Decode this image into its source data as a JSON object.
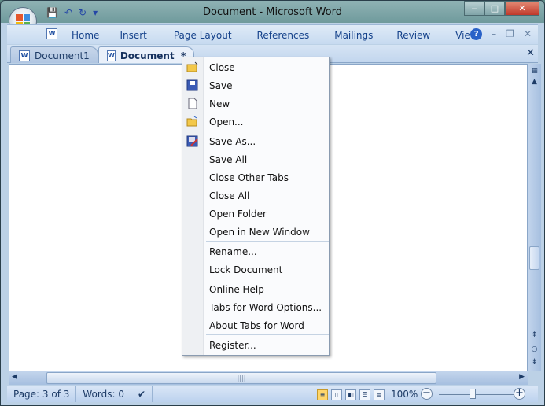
{
  "window": {
    "title": "Document - Microsoft Word",
    "minimize": "‒",
    "maximize": "□",
    "close": "✕"
  },
  "qat": {
    "save_icon": "💾",
    "undo": "↶",
    "redo": "↻",
    "customize": "▾"
  },
  "ribbon": {
    "tabs": [
      "Home",
      "Insert",
      "Page Layout",
      "References",
      "Mailings",
      "Review",
      "View"
    ]
  },
  "doc_tabs": [
    {
      "label": "Document1"
    },
    {
      "label": "Document  *"
    }
  ],
  "menu": {
    "groups": [
      [
        {
          "label": "Close",
          "u": 0,
          "icon": "close-folder"
        },
        {
          "label": "Save",
          "u": 0,
          "icon": "save"
        },
        {
          "label": "New",
          "u": 0,
          "icon": "new"
        },
        {
          "label": "Open...",
          "u": 0,
          "icon": "open"
        }
      ],
      [
        {
          "label": "Save As...",
          "u": 5,
          "icon": "save-as"
        },
        {
          "label": "Save All",
          "u": 2
        },
        {
          "label": "Close Other Tabs",
          "u": 12
        },
        {
          "label": "Close All",
          "u": 4
        },
        {
          "label": "Open Folder",
          "u": 8
        },
        {
          "label": "Open in New Window",
          "u": 0
        }
      ],
      [
        {
          "label": "Rename...",
          "u": 0
        },
        {
          "label": "Lock Document",
          "u": 0
        }
      ],
      [
        {
          "label": "Online Help",
          "u": 7
        },
        {
          "label": "Tabs for Word Options...",
          "u": 9
        },
        {
          "label": "About Tabs for Word",
          "u": -1
        }
      ],
      [
        {
          "label": "Register...",
          "u": 0
        }
      ]
    ]
  },
  "status": {
    "page": "Page: 3 of 3",
    "words": "Words: 0",
    "zoom": "100%",
    "zoom_percent": 100
  }
}
